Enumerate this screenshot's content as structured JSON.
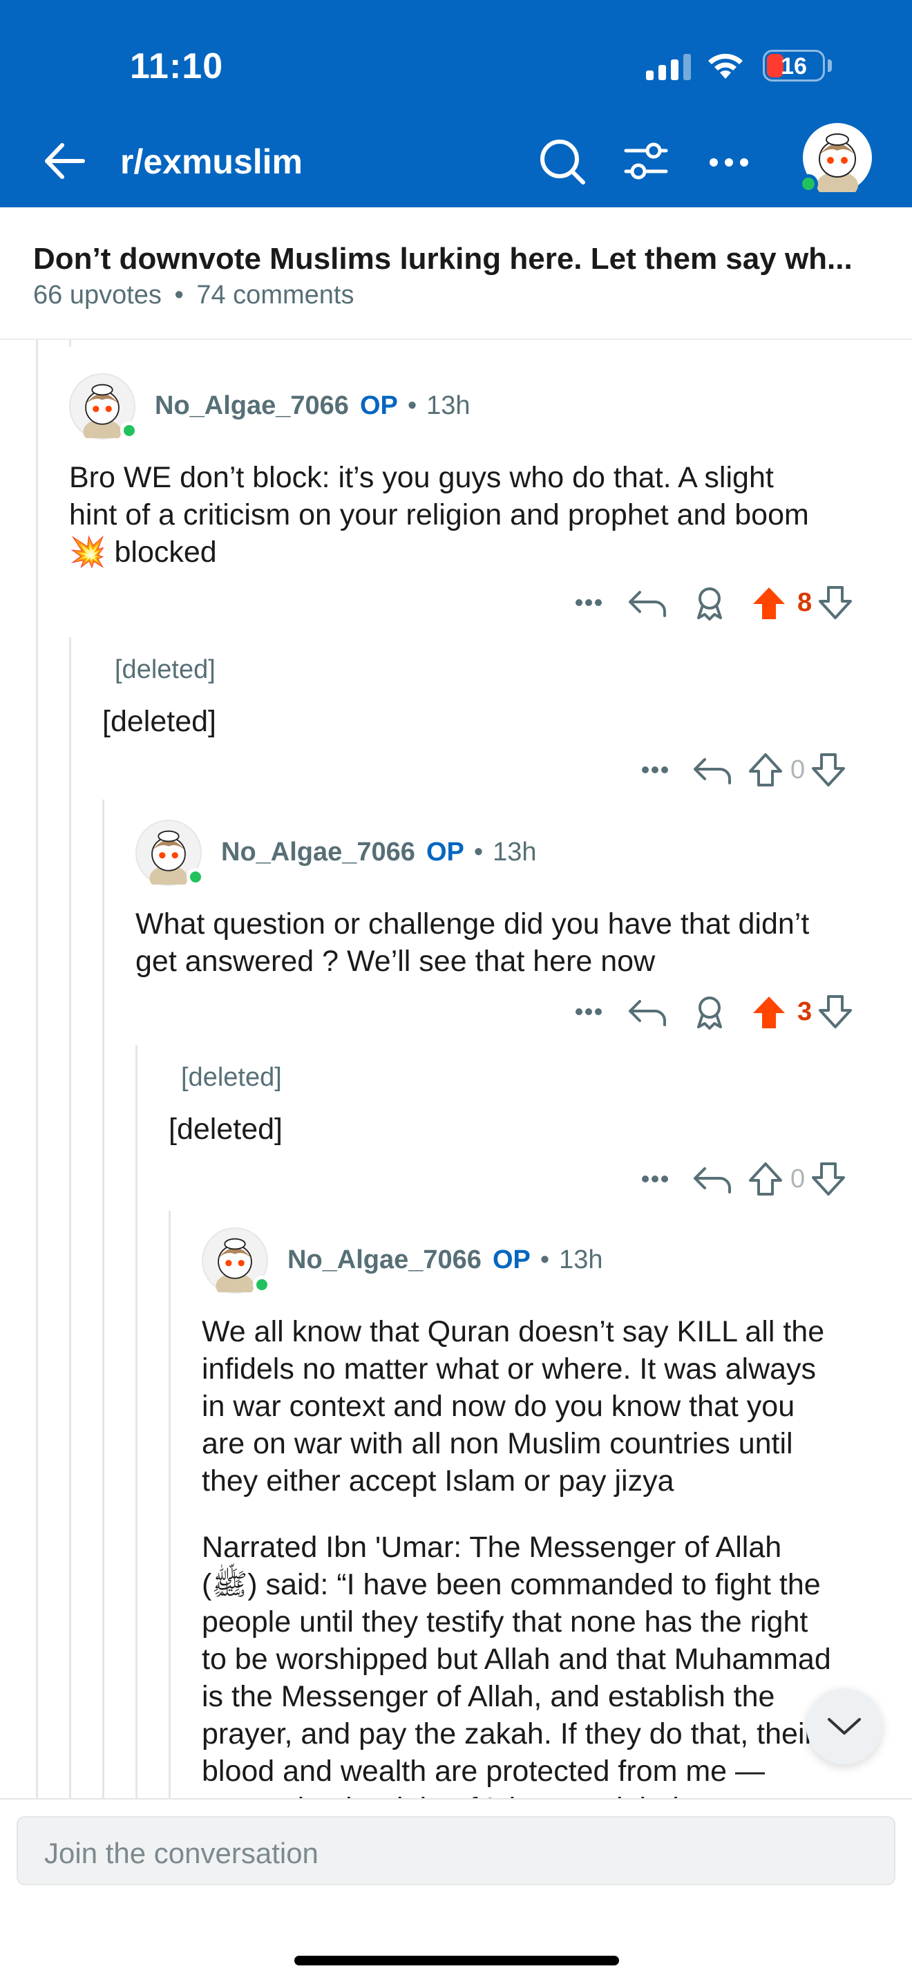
{
  "status_bar": {
    "time": "11:10",
    "battery": "16"
  },
  "header": {
    "subreddit": "r/exmuslim"
  },
  "post": {
    "title": "Don’t downvote Muslims lurking here. Let them say wh...",
    "upvotes": "66 upvotes",
    "separator": "•",
    "comments": "74 comments"
  },
  "comments": [
    {
      "author": "No_Algae_7066",
      "op": "OP",
      "sep": "•",
      "time": "13h",
      "lines": [
        "Bro WE don’t block: it’s you guys who do that. A slight",
        "hint of a criticism on your religion and prophet and boom",
        "💥 blocked"
      ],
      "votes": "8"
    },
    {
      "author": "[deleted]",
      "body": "[deleted]",
      "votes": "0"
    },
    {
      "author": "No_Algae_7066",
      "op": "OP",
      "sep": "•",
      "time": "13h",
      "lines": [
        "What question or challenge did you have that didn’t",
        "get answered ? We’ll see that here now"
      ],
      "votes": "3"
    },
    {
      "author": "[deleted]",
      "body": "[deleted]",
      "votes": "0"
    },
    {
      "author": "No_Algae_7066",
      "op": "OP",
      "sep": "•",
      "time": "13h",
      "para1": [
        "We all know that Quran doesn’t say KILL all the",
        "infidels no matter what or where. It was always",
        "in war context and now do you know that you",
        "are on war with all non Muslim countries until",
        "they either accept Islam or pay jizya"
      ],
      "para2": [
        "Narrated Ibn 'Umar: The Messenger of Allah",
        "(ﷺ) said: “I have been commanded to fight the",
        "people until they testify that none has the right",
        "to be worshipped but Allah and that Muhammad",
        "is the Messenger of Allah, and establish the",
        "prayer, and pay the zakah. If they do that, their",
        "blood and wealth are protected from me —",
        "except by the right of Islam, and their account"
      ]
    }
  ],
  "composer": {
    "placeholder": "Join the conversation"
  },
  "colors": {
    "brand_blue": "#0466c0",
    "upvote_orange": "#ff4500",
    "op_blue": "#0466c0",
    "online_green": "#21c25e"
  },
  "icons": [
    "back-arrow-icon",
    "search-icon",
    "filter-icon",
    "more-icon",
    "reply-icon",
    "award-icon",
    "upvote-icon",
    "downvote-icon",
    "chevron-down-icon"
  ]
}
